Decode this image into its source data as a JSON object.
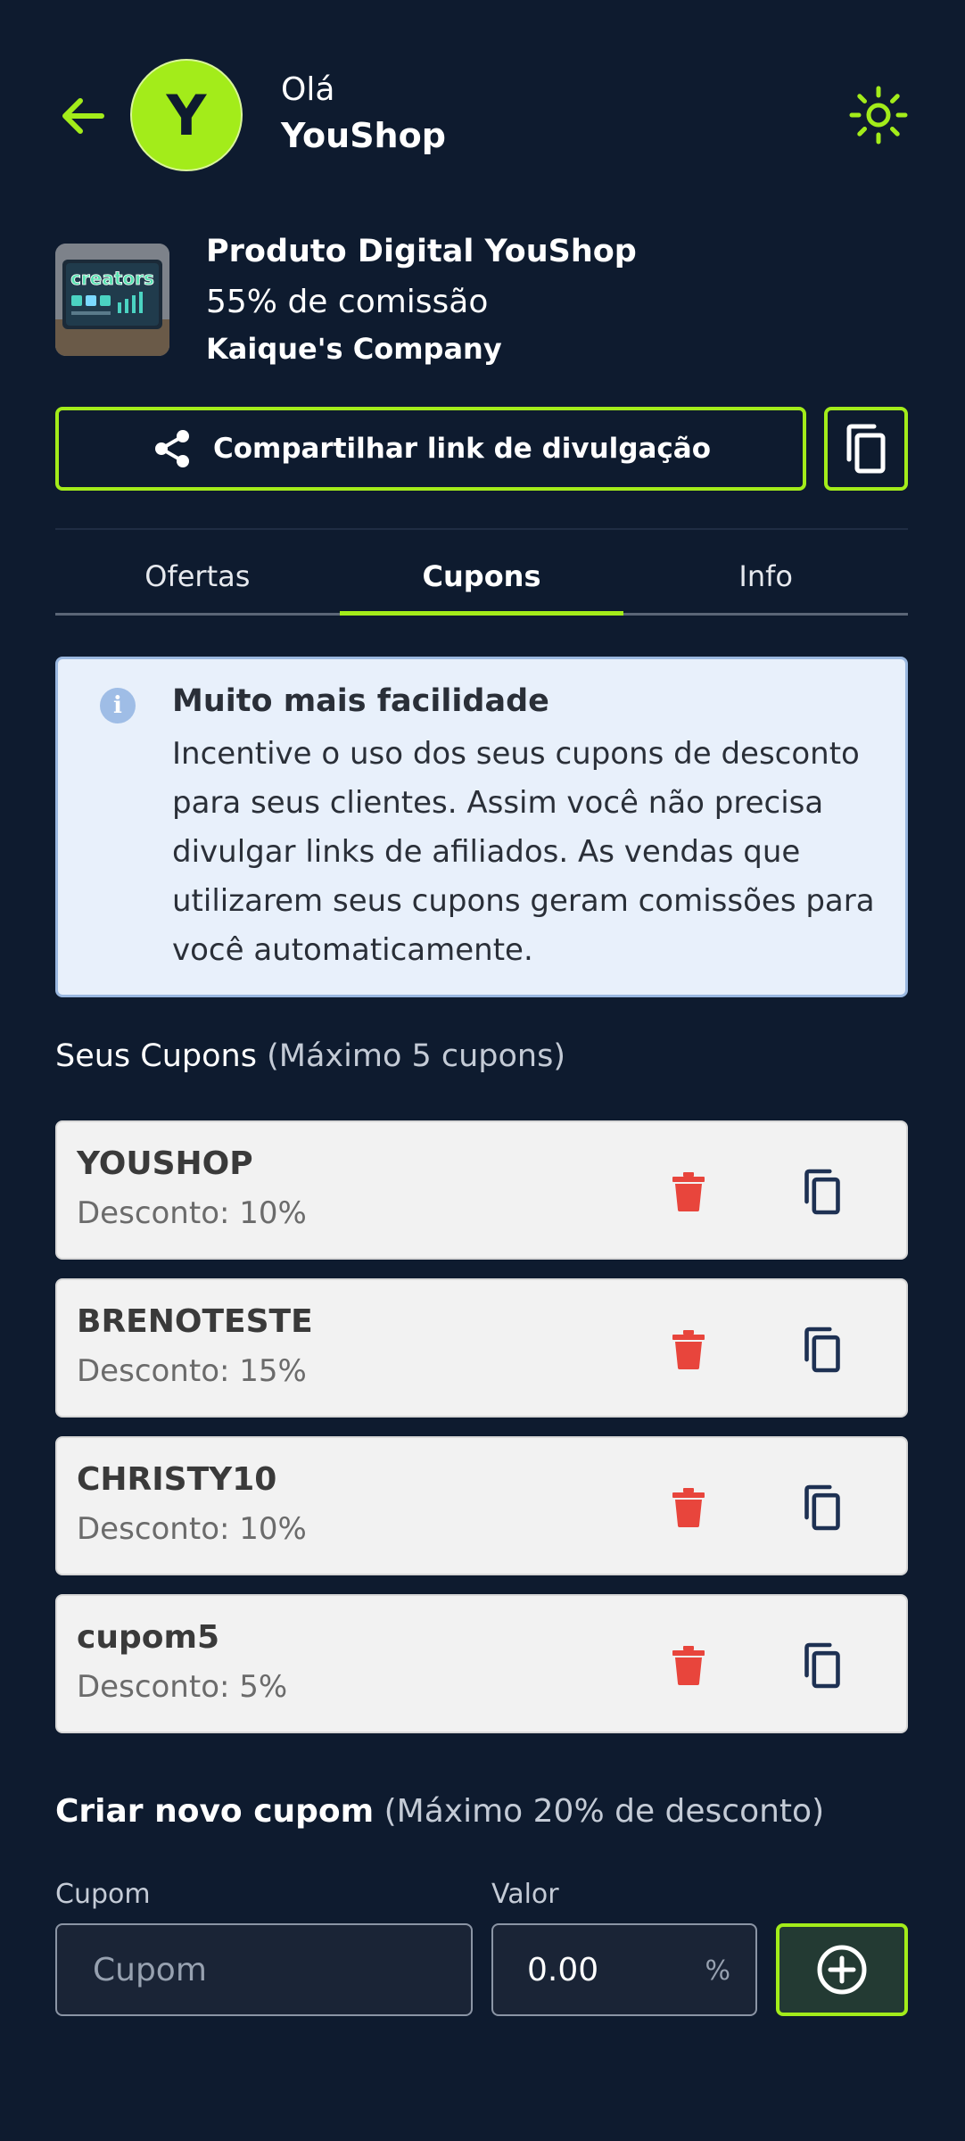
{
  "header": {
    "avatar_letter": "Y",
    "greeting": "Olá",
    "user_name": "YouShop",
    "back_icon": "arrow-left-icon",
    "theme_icon": "sun-icon"
  },
  "product": {
    "image_text": "creators",
    "title": "Produto Digital YouShop",
    "commission": "55% de comissão",
    "company": "Kaique's Company"
  },
  "share": {
    "label": "Compartilhar link de divulgação",
    "share_icon": "share-icon",
    "copy_icon": "copy-icon"
  },
  "tabs": [
    {
      "label": "Ofertas",
      "active": false
    },
    {
      "label": "Cupons",
      "active": true
    },
    {
      "label": "Info",
      "active": false
    }
  ],
  "info": {
    "icon": "info-icon",
    "title": "Muito mais facilidade",
    "text": "Incentive o uso dos seus cupons de desconto para seus clientes. Assim você não precisa divulgar links de afiliados. As vendas que utilizarem seus cupons geram comissões para você automaticamente."
  },
  "coupons_section": {
    "title": "Seus Cupons",
    "subtitle": "(Máximo 5 cupons)"
  },
  "coupons": [
    {
      "code": "YOUSHOP",
      "discount": "Desconto: 10%"
    },
    {
      "code": "BRENOTESTE",
      "discount": "Desconto: 15%"
    },
    {
      "code": "CHRISTY10",
      "discount": "Desconto: 10%"
    },
    {
      "code": "cupom5",
      "discount": "Desconto: 5%"
    }
  ],
  "create": {
    "title": "Criar novo cupom",
    "subtitle": "(Máximo 20% de desconto)",
    "coupon_label": "Cupom",
    "coupon_placeholder": "Cupom",
    "value_label": "Valor",
    "value_placeholder": "0.00",
    "percent_suffix": "%",
    "add_icon": "plus-circle-icon"
  },
  "colors": {
    "background": "#0e1b2f",
    "accent": "#a3ec1a",
    "delete": "#e8453c",
    "info_bg": "#e8f0fb"
  }
}
